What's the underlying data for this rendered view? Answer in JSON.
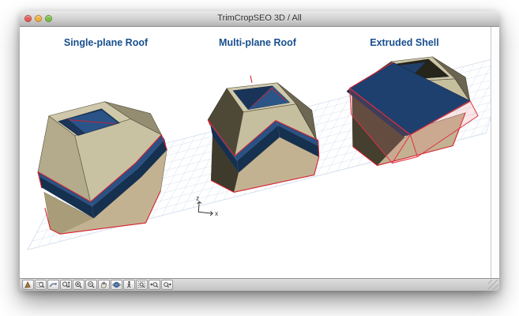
{
  "window": {
    "title": "TrimCropSEO 3D / All"
  },
  "traffic_lights": {
    "close_color": "#e65a52",
    "minimize_color": "#f0ad3f",
    "zoom_color": "#79c043"
  },
  "scene": {
    "labels": [
      "Single-plane Roof",
      "Multi-plane Roof",
      "Extruded Shell"
    ],
    "axis": {
      "z": "z",
      "x": "x"
    },
    "colors": {
      "label_text": "#184f8e",
      "roof_navy": "#1e406f",
      "roof_navy_dark": "#16304f",
      "solid_tan_light": "#c8c1a2",
      "solid_tan_dark": "#a89d78",
      "shaded_olive": "#4e4937",
      "edge_red": "#d8212f",
      "shell_pink": "rgba(236,128,138,0.20)",
      "grid_line": "#c6d4e9"
    }
  },
  "toolbar": {
    "buttons": [
      "explore-tool",
      "zoom-window-tool",
      "orbit-page-tool",
      "interactive-zoom-tool",
      "zoom-in-tool",
      "zoom-out-tool",
      "pan-tool",
      "orbit-view-tool",
      "walk-tool",
      "fit-in-window-tool",
      "previous-view-tool",
      "next-view-tool"
    ]
  }
}
